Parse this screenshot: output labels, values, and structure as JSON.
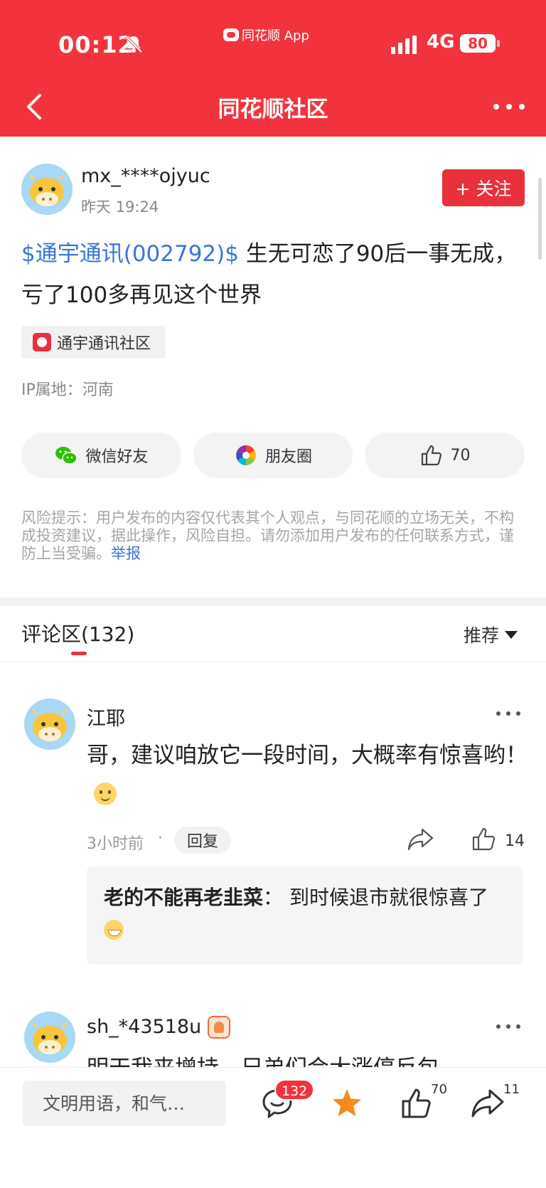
{
  "status_bar": {
    "time": "00:12",
    "app_label": "同花顺 App",
    "network": "4G",
    "battery": "80"
  },
  "nav": {
    "title": "同花顺社区"
  },
  "post": {
    "username": "mx_****ojyuc",
    "time": "昨天 19:24",
    "follow_label": "+ 关注",
    "stock_link": "$通宇通讯(002792)$",
    "text": " 生无可恋了90后一事无成，亏了100多再见这个世界",
    "community_tag": "通宇通讯社区",
    "ip_location": "IP属地：河南",
    "share_wechat": "微信好友",
    "share_moments": "朋友圈",
    "like_count": "70",
    "risk_text": "风险提示：用户发布的内容仅代表其个人观点，与同花顺的立场无关，不构成投资建议，据此操作，风险自担。请勿添加用户发布的任何联系方式，谨防上当受骗。",
    "report_label": "举报"
  },
  "comments_section": {
    "title": "评论区(132)",
    "sort_label": "推荐"
  },
  "comments": [
    {
      "username": "江耶",
      "text": "哥，建议咱放它一段时间，大概率有惊喜哟！",
      "time": "3小时前",
      "separator": "·",
      "reply_label": "回复",
      "like_count": "14",
      "reply": {
        "username": "老的不能再老韭菜",
        "separator": "：",
        "text": "到时候退市就很惊喜了"
      }
    },
    {
      "username": "sh_*43518u",
      "text": "明天我来增持，兄弟们会大涨停反包"
    }
  ],
  "bottom_bar": {
    "input_placeholder": "文明用语，和气…",
    "comment_count": "132",
    "like_count": "70",
    "share_count": "11"
  },
  "colors": {
    "brand_red": "#f2333d",
    "link_blue": "#3a75d6",
    "star_orange": "#f58a1f"
  }
}
